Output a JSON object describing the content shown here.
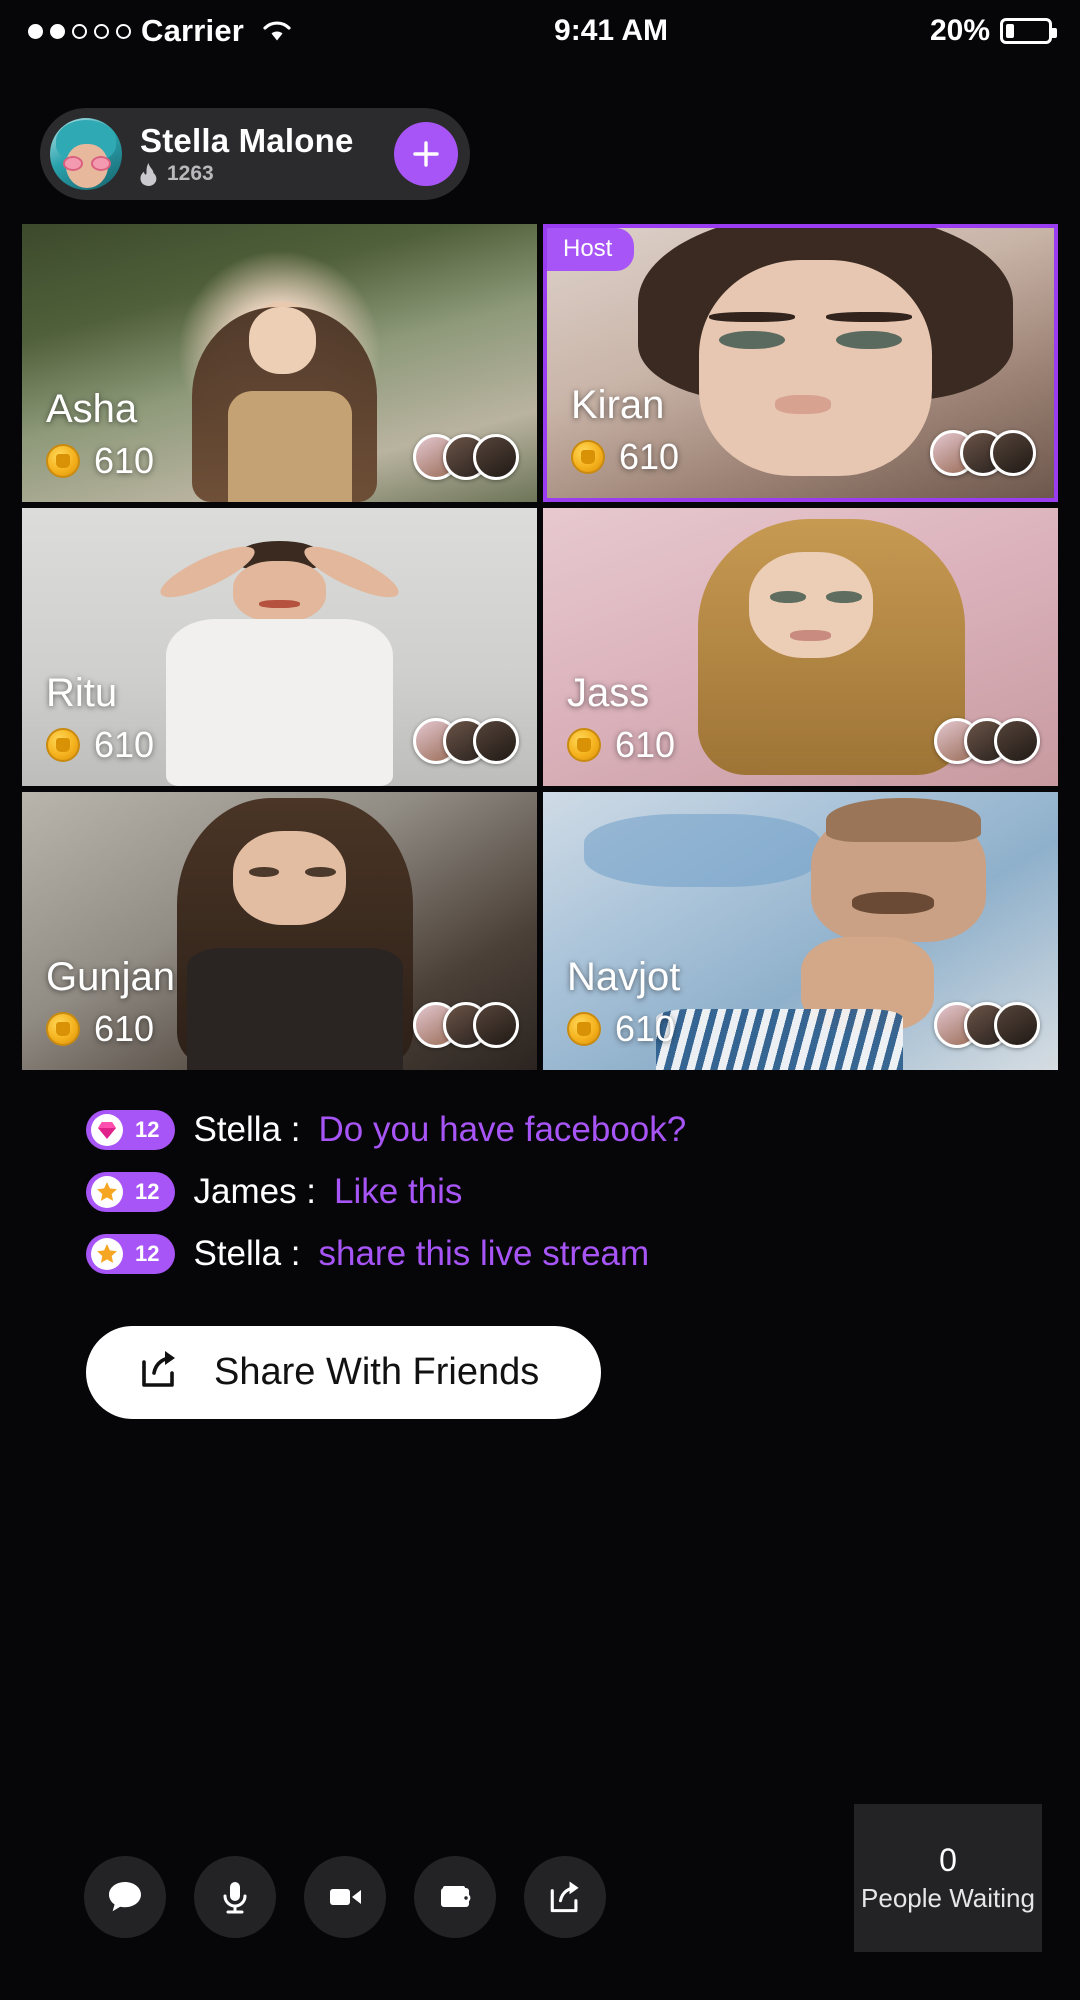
{
  "status_bar": {
    "carrier": "Carrier",
    "time": "9:41 AM",
    "battery_pct": "20%",
    "signal_dots_filled": 2,
    "signal_dots_total": 5,
    "wifi_icon": "wifi-icon",
    "battery_icon": "battery-icon"
  },
  "header": {
    "name": "Stella Malone",
    "count": "1263",
    "flame_icon": "flame-icon",
    "avatar": "host-avatar",
    "add_icon": "plus-icon"
  },
  "grid": {
    "host_badge": "Host",
    "cards": [
      {
        "name": "Asha",
        "coins": "610",
        "is_host": false
      },
      {
        "name": "Kiran",
        "coins": "610",
        "is_host": true
      },
      {
        "name": "Ritu",
        "coins": "610",
        "is_host": false
      },
      {
        "name": "Jass",
        "coins": "610",
        "is_host": false
      },
      {
        "name": "Gunjan",
        "coins": "610",
        "is_host": false
      },
      {
        "name": "Navjot",
        "coins": "610",
        "is_host": false
      }
    ]
  },
  "chat": {
    "messages": [
      {
        "badge_icon": "diamond-icon",
        "badge_count": "12",
        "user": "Stella :",
        "text": "Do you have facebook?"
      },
      {
        "badge_icon": "star-icon",
        "badge_count": "12",
        "user": "James :",
        "text": "Like this"
      },
      {
        "badge_icon": "star-icon",
        "badge_count": "12",
        "user": "Stella :",
        "text": "share this live stream"
      }
    ]
  },
  "share_button": {
    "label": "Share With Friends",
    "icon": "share-icon"
  },
  "toolbar": {
    "items": [
      {
        "icon": "chat-bubble-icon",
        "name": "chat"
      },
      {
        "icon": "microphone-icon",
        "name": "mic"
      },
      {
        "icon": "video-camera-icon",
        "name": "video"
      },
      {
        "icon": "wallet-icon",
        "name": "wallet"
      },
      {
        "icon": "share-icon",
        "name": "share"
      }
    ]
  },
  "waiting_panel": {
    "count": "0",
    "label": "People Waiting"
  },
  "colors": {
    "accent_purple": "#a855f7",
    "host_border": "#9a3df0",
    "coin_gold": "#f5b21e",
    "background": "#060609",
    "surface": "#232326"
  }
}
